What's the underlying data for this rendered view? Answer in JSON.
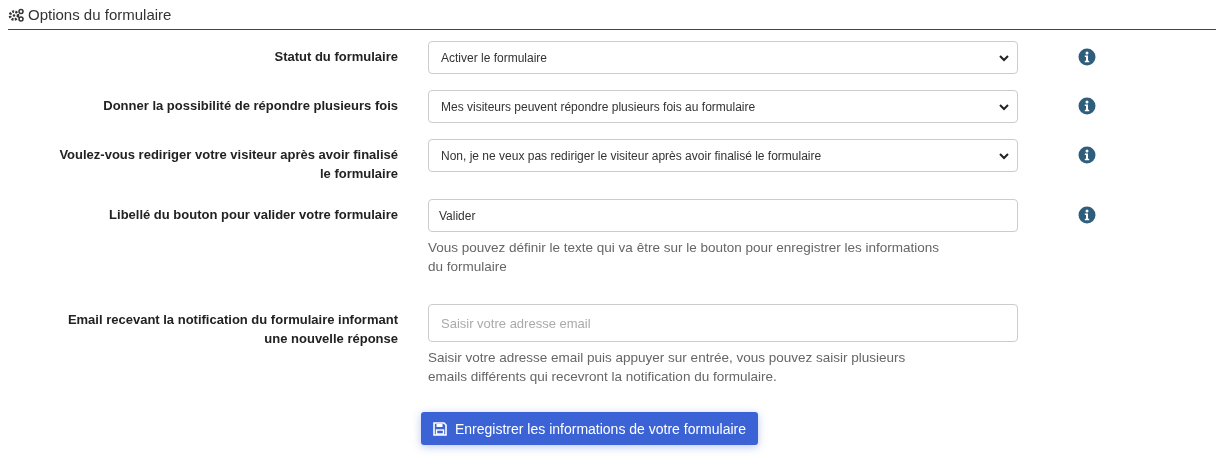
{
  "section": {
    "title": "Options du formulaire"
  },
  "fields": [
    {
      "kind": "select",
      "label": "Statut du formulaire",
      "value": "Activer le formulaire",
      "info": true
    },
    {
      "kind": "select",
      "label": "Donner la possibilité de répondre plusieurs fois",
      "value": "Mes visiteurs peuvent répondre plusieurs fois au formulaire",
      "info": true
    },
    {
      "kind": "select",
      "label": "Voulez-vous rediriger votre visiteur après avoir finalisé le formulaire",
      "value": "Non, je ne veux pas rediriger le visiteur après avoir finalisé le formulaire",
      "info": true
    },
    {
      "kind": "text",
      "label": "Libellé du bouton pour valider votre formulaire",
      "value": "Valider",
      "help": "Vous pouvez définir le texte qui va être sur le bouton pour enregistrer les informations du formulaire",
      "info": true
    },
    {
      "kind": "text",
      "label": "Email recevant la notification du formulaire informant une nouvelle réponse",
      "placeholder": "Saisir votre adresse email",
      "help": "Saisir votre adresse email puis appuyer sur entrée, vous pouvez saisir plusieurs emails différents qui recevront la notification du formulaire.",
      "info": false
    }
  ],
  "save_button": "Enregistrer les informations de votre formulaire"
}
